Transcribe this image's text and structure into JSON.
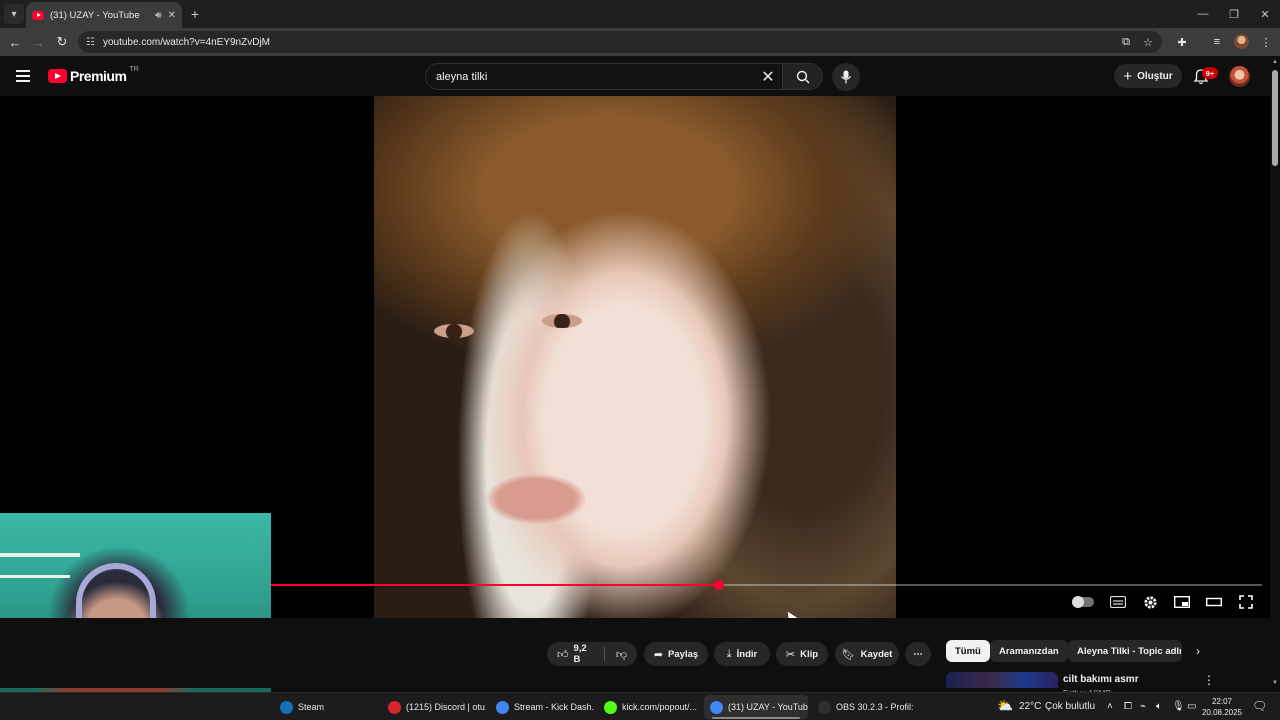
{
  "browser": {
    "tab_title": "(31) UZAY - YouTube",
    "url": "youtube.com/watch?v=4nEY9nZvDjM",
    "new_tab_symbol": "+",
    "min_symbol": "—",
    "restore_symbol": "❐",
    "close_symbol": "✕"
  },
  "youtube": {
    "logo_text": "Premium",
    "country_code": "TR",
    "search_value": "aleyna tilki",
    "create_label": "Oluştur",
    "notification_count": "9+"
  },
  "player": {
    "progress_fraction": 0.452
  },
  "actions": {
    "like_count": "9,2 B",
    "share": "Paylaş",
    "download": "İndir",
    "clip": "Klip",
    "save": "Kaydet",
    "more": "⋯"
  },
  "chips": [
    "Tümü",
    "Aramanızdan",
    "Aleyna Tilki - Topic adlı y"
  ],
  "recommendation": {
    "title": "cilt bakımı asmr",
    "channel": "Esther ASMR"
  },
  "taskbar": {
    "items": [
      {
        "label": "Steam",
        "color": "#1b6fb8"
      },
      {
        "label": "(1215) Discord | otu...",
        "color": "#d9252a"
      },
      {
        "label": "Stream - Kick Dash...",
        "color": "#4285f4"
      },
      {
        "label": "kick.com/popout/...",
        "color": "#53fc18"
      },
      {
        "label": "(31) UZAY - YouTub...",
        "color": "#4285f4"
      },
      {
        "label": "OBS 30.2.3 - Profil: l...",
        "color": "#302e31"
      }
    ],
    "weather_temp": "22°C",
    "weather_text": "Çok bulutlu",
    "time": "22:07",
    "date": "20.08.2025"
  },
  "colors": {
    "accent": "#ff0033",
    "background": "#0f0f0f",
    "chrome": "#3c3c3c"
  }
}
